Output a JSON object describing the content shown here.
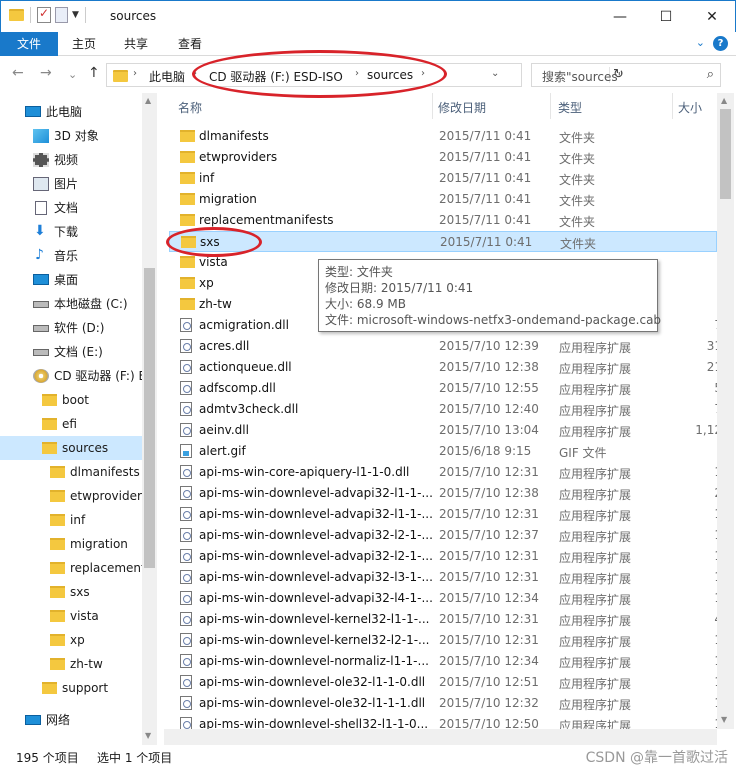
{
  "window": {
    "title": "sources",
    "minimize": "—",
    "maximize": "☐",
    "close": "✕"
  },
  "ribbon": {
    "tabs": [
      "文件",
      "主页",
      "共享",
      "查看"
    ],
    "expand": "⌄",
    "help": "?"
  },
  "nav": {
    "back": "←",
    "forward": "→",
    "recent": "⌄",
    "up": "↑",
    "breadcrumb": [
      "此电脑",
      "CD 驱动器 (F:) ESD-ISO",
      "sources"
    ],
    "dropdown": "⌄",
    "refresh": "↻",
    "search_placeholder": "搜索\"sources\"",
    "search_icon": "search-icon"
  },
  "sidebar": {
    "items": [
      {
        "label": "此电脑",
        "icon": "pc-icon"
      },
      {
        "label": "3D 对象",
        "icon": "3d-objects-icon"
      },
      {
        "label": "视频",
        "icon": "video-icon"
      },
      {
        "label": "图片",
        "icon": "pictures-icon"
      },
      {
        "label": "文档",
        "icon": "documents-icon"
      },
      {
        "label": "下载",
        "icon": "download-icon"
      },
      {
        "label": "音乐",
        "icon": "music-icon"
      },
      {
        "label": "桌面",
        "icon": "desktop-icon"
      },
      {
        "label": "本地磁盘 (C:)",
        "icon": "drive-icon"
      },
      {
        "label": "软件 (D:)",
        "icon": "drive-icon"
      },
      {
        "label": "文档 (E:)",
        "icon": "drive-icon"
      },
      {
        "label": "CD 驱动器 (F:) E",
        "icon": "cd-drive-icon"
      },
      {
        "label": "boot",
        "icon": "folder-icon"
      },
      {
        "label": "efi",
        "icon": "folder-icon"
      },
      {
        "label": "sources",
        "icon": "folder-icon",
        "selected": true
      },
      {
        "label": "dlmanifests",
        "icon": "folder-icon"
      },
      {
        "label": "etwprovider",
        "icon": "folder-icon"
      },
      {
        "label": "inf",
        "icon": "folder-icon"
      },
      {
        "label": "migration",
        "icon": "folder-icon"
      },
      {
        "label": "replacement",
        "icon": "folder-icon"
      },
      {
        "label": "sxs",
        "icon": "folder-icon"
      },
      {
        "label": "vista",
        "icon": "folder-icon"
      },
      {
        "label": "xp",
        "icon": "folder-icon"
      },
      {
        "label": "zh-tw",
        "icon": "folder-icon"
      },
      {
        "label": "support",
        "icon": "folder-icon"
      },
      {
        "label": "网络",
        "icon": "network-icon"
      }
    ]
  },
  "columns": {
    "name": "名称",
    "date": "修改日期",
    "type": "类型",
    "size": "大小"
  },
  "files": [
    {
      "name": "dlmanifests",
      "date": "2015/7/11 0:41",
      "type": "文件夹",
      "size": "",
      "kind": "folder"
    },
    {
      "name": "etwproviders",
      "date": "2015/7/11 0:41",
      "type": "文件夹",
      "size": "",
      "kind": "folder"
    },
    {
      "name": "inf",
      "date": "2015/7/11 0:41",
      "type": "文件夹",
      "size": "",
      "kind": "folder"
    },
    {
      "name": "migration",
      "date": "2015/7/11 0:41",
      "type": "文件夹",
      "size": "",
      "kind": "folder"
    },
    {
      "name": "replacementmanifests",
      "date": "2015/7/11 0:41",
      "type": "文件夹",
      "size": "",
      "kind": "folder"
    },
    {
      "name": "sxs",
      "date": "2015/7/11 0:41",
      "type": "文件夹",
      "size": "",
      "kind": "folder",
      "selected": true
    },
    {
      "name": "vista",
      "date": "",
      "type": "",
      "size": "",
      "kind": "folder"
    },
    {
      "name": "xp",
      "date": "",
      "type": "",
      "size": "",
      "kind": "folder"
    },
    {
      "name": "zh-tw",
      "date": "",
      "type": "",
      "size": "",
      "kind": "folder"
    },
    {
      "name": "acmigration.dll",
      "date": "",
      "type": "",
      "size": "7",
      "kind": "dll"
    },
    {
      "name": "acres.dll",
      "date": "2015/7/10 12:39",
      "type": "应用程序扩展",
      "size": "31",
      "kind": "dll"
    },
    {
      "name": "actionqueue.dll",
      "date": "2015/7/10 12:38",
      "type": "应用程序扩展",
      "size": "21",
      "kind": "dll"
    },
    {
      "name": "adfscomp.dll",
      "date": "2015/7/10 12:55",
      "type": "应用程序扩展",
      "size": "5",
      "kind": "dll"
    },
    {
      "name": "admtv3check.dll",
      "date": "2015/7/10 12:40",
      "type": "应用程序扩展",
      "size": "7",
      "kind": "dll"
    },
    {
      "name": "aeinv.dll",
      "date": "2015/7/10 13:04",
      "type": "应用程序扩展",
      "size": "1,12",
      "kind": "dll"
    },
    {
      "name": "alert.gif",
      "date": "2015/6/18 9:15",
      "type": "GIF 文件",
      "size": "",
      "kind": "gif"
    },
    {
      "name": "api-ms-win-core-apiquery-l1-1-0.dll",
      "date": "2015/7/10 12:31",
      "type": "应用程序扩展",
      "size": "1",
      "kind": "dll"
    },
    {
      "name": "api-ms-win-downlevel-advapi32-l1-1-...",
      "date": "2015/7/10 12:38",
      "type": "应用程序扩展",
      "size": "2",
      "kind": "dll"
    },
    {
      "name": "api-ms-win-downlevel-advapi32-l1-1-...",
      "date": "2015/7/10 12:31",
      "type": "应用程序扩展",
      "size": "1",
      "kind": "dll"
    },
    {
      "name": "api-ms-win-downlevel-advapi32-l2-1-...",
      "date": "2015/7/10 12:37",
      "type": "应用程序扩展",
      "size": "1",
      "kind": "dll"
    },
    {
      "name": "api-ms-win-downlevel-advapi32-l2-1-...",
      "date": "2015/7/10 12:31",
      "type": "应用程序扩展",
      "size": "1",
      "kind": "dll"
    },
    {
      "name": "api-ms-win-downlevel-advapi32-l3-1-...",
      "date": "2015/7/10 12:31",
      "type": "应用程序扩展",
      "size": "1",
      "kind": "dll"
    },
    {
      "name": "api-ms-win-downlevel-advapi32-l4-1-...",
      "date": "2015/7/10 12:34",
      "type": "应用程序扩展",
      "size": "1",
      "kind": "dll"
    },
    {
      "name": "api-ms-win-downlevel-kernel32-l1-1-...",
      "date": "2015/7/10 12:31",
      "type": "应用程序扩展",
      "size": "4",
      "kind": "dll"
    },
    {
      "name": "api-ms-win-downlevel-kernel32-l2-1-...",
      "date": "2015/7/10 12:31",
      "type": "应用程序扩展",
      "size": "1",
      "kind": "dll"
    },
    {
      "name": "api-ms-win-downlevel-normaliz-l1-1-...",
      "date": "2015/7/10 12:34",
      "type": "应用程序扩展",
      "size": "1",
      "kind": "dll"
    },
    {
      "name": "api-ms-win-downlevel-ole32-l1-1-0.dll",
      "date": "2015/7/10 12:51",
      "type": "应用程序扩展",
      "size": "1",
      "kind": "dll"
    },
    {
      "name": "api-ms-win-downlevel-ole32-l1-1-1.dll",
      "date": "2015/7/10 12:32",
      "type": "应用程序扩展",
      "size": "1",
      "kind": "dll"
    },
    {
      "name": "api-ms-win-downlevel-shell32-l1-1-0...",
      "date": "2015/7/10 12:50",
      "type": "应用程序扩展",
      "size": "1",
      "kind": "dll"
    }
  ],
  "tooltip": {
    "lines": [
      "类型: 文件夹",
      "修改日期: 2015/7/11 0:41",
      "大小: 68.9 MB",
      "文件: microsoft-windows-netfx3-ondemand-package.cab"
    ]
  },
  "status": {
    "count": "195 个项目",
    "selected": "选中 1 个项目",
    "watermark": "CSDN @靠一首歌过活"
  },
  "colors": {
    "accent": "#1979ca",
    "selection": "#cce8ff",
    "annotation_red": "#d8232a"
  }
}
